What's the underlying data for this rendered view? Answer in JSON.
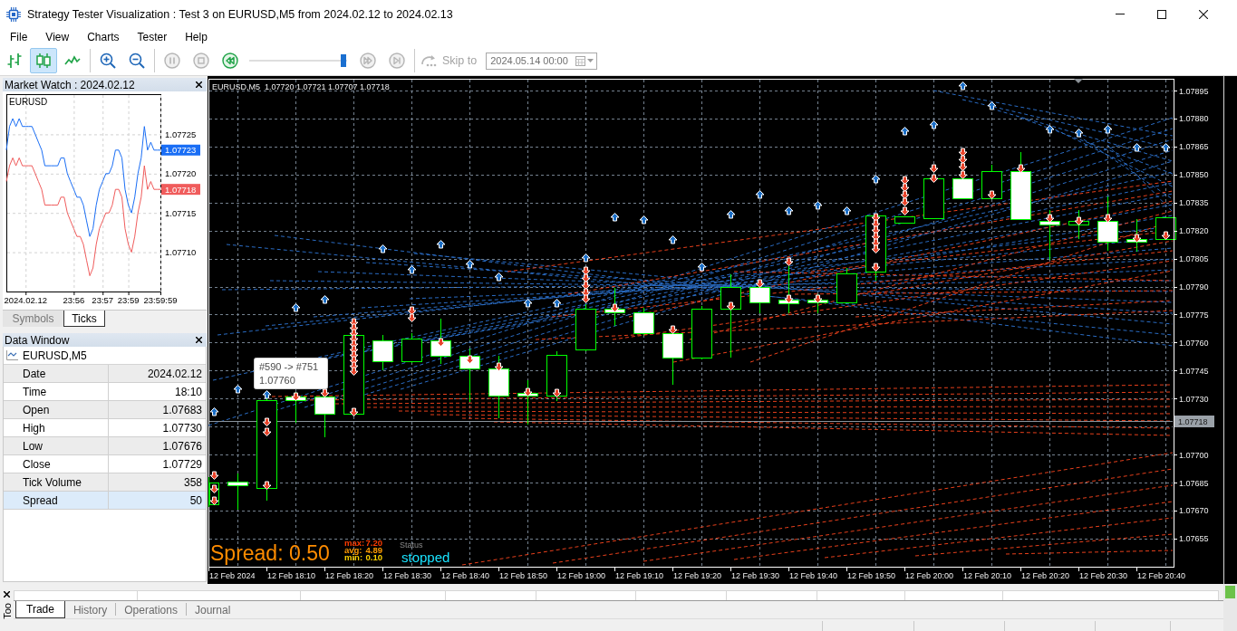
{
  "window": {
    "title": "Strategy Tester Visualization : Test 3 on EURUSD,M5 from 2024.02.12 to 2024.02.13"
  },
  "menu": [
    "File",
    "View",
    "Charts",
    "Tester",
    "Help"
  ],
  "toolbar": {
    "chart_modes": [
      {
        "kind": "bars",
        "selected": false
      },
      {
        "kind": "candles",
        "selected": true
      },
      {
        "kind": "line",
        "selected": false
      }
    ],
    "zoom": [
      {
        "kind": "zoom-in"
      },
      {
        "kind": "zoom-out"
      }
    ],
    "playback": [
      {
        "kind": "pause",
        "disabled": true
      },
      {
        "kind": "stop",
        "disabled": true
      },
      {
        "kind": "rewind",
        "disabled": false
      }
    ],
    "speed": {
      "level": 0.99
    },
    "stepping": [
      {
        "kind": "forward",
        "disabled": true
      },
      {
        "kind": "to-end",
        "disabled": true
      }
    ],
    "skip_to": {
      "label": "Skip to",
      "value": "2024.05.14 00:00",
      "disabled": true
    }
  },
  "market_watch": {
    "title": "Market Watch : 2024.02.12",
    "chart_data": {
      "type": "line",
      "title": "EURUSD",
      "grid": true,
      "categories": [
        null,
        null,
        null,
        null,
        null,
        null,
        "2024.02.12",
        null,
        null,
        null,
        null,
        null,
        null,
        null,
        null,
        null,
        null,
        null,
        null,
        null,
        null,
        "23:56",
        null,
        null,
        null,
        null,
        null,
        null,
        null,
        null,
        "23:57",
        null,
        null,
        null,
        null,
        null,
        null,
        null,
        "23:59",
        null,
        null,
        null,
        null,
        null,
        null,
        null,
        null,
        null,
        "23:59:59"
      ],
      "ylim": [
        1.07705,
        1.0773
      ],
      "yticks": [
        {
          "value": 1.07725,
          "label": "1.07725"
        },
        {
          "value": 1.0772,
          "label": "1.07720"
        },
        {
          "value": 1.07715,
          "label": "1.07715"
        },
        {
          "value": 1.0771,
          "label": "1.07710"
        }
      ],
      "series": [
        {
          "color": "#1a6ef5",
          "values": [
            1.07723,
            1.07726,
            1.07727,
            1.07726,
            1.07727,
            1.07726,
            1.07726,
            1.07726,
            1.07726,
            1.07725,
            1.07724,
            1.07723,
            1.07721,
            1.07721,
            1.07721,
            1.07721,
            1.07721,
            1.07722,
            1.07722,
            1.0772,
            1.07719,
            1.07718,
            1.07717,
            1.07717,
            1.07716,
            1.07714,
            1.07712,
            1.07713,
            1.07716,
            1.07718,
            1.07719,
            1.0772,
            1.0772,
            1.07721,
            1.07723,
            1.07723,
            1.07722,
            1.07718,
            1.07716,
            1.07715,
            1.07717,
            1.0772,
            1.07722,
            1.07726,
            1.07723,
            1.07724,
            1.07723,
            1.07723,
            1.07723
          ]
        },
        {
          "color": "#f05c5c",
          "values": [
            1.07719,
            1.07721,
            1.07722,
            1.07721,
            1.07722,
            1.07721,
            1.07721,
            1.07721,
            1.07721,
            1.0772,
            1.07719,
            1.07718,
            1.07716,
            1.07716,
            1.07716,
            1.07716,
            1.07716,
            1.07717,
            1.07717,
            1.07715,
            1.07714,
            1.07713,
            1.07712,
            1.07712,
            1.07711,
            1.07709,
            1.07707,
            1.07708,
            1.07711,
            1.07713,
            1.07714,
            1.07715,
            1.07715,
            1.07716,
            1.07718,
            1.07718,
            1.07717,
            1.07713,
            1.07711,
            1.0771,
            1.07712,
            1.07715,
            1.07717,
            1.07721,
            1.07718,
            1.07719,
            1.07718,
            1.07718,
            1.07718
          ]
        }
      ]
    },
    "price_badges": [
      "1.07723",
      "1.07718"
    ],
    "tabs": [
      {
        "label": "Symbols",
        "selected": false
      },
      {
        "label": "Ticks",
        "selected": true
      }
    ]
  },
  "data_window": {
    "title": "Data Window",
    "series": "EURUSD,M5",
    "rows": [
      {
        "label": "Date",
        "value": "2024.02.12",
        "selected": false
      },
      {
        "label": "Time",
        "value": "18:10",
        "selected": false
      },
      {
        "label": "Open",
        "value": "1.07683",
        "selected": false
      },
      {
        "label": "High",
        "value": "1.07730",
        "selected": false
      },
      {
        "label": "Low",
        "value": "1.07676",
        "selected": false
      },
      {
        "label": "Close",
        "value": "1.07729",
        "selected": false
      },
      {
        "label": "Tick Volume",
        "value": "358",
        "selected": false
      },
      {
        "label": "Spread",
        "value": "50",
        "selected": true
      }
    ]
  },
  "chart": {
    "symbol": "EURUSD,M5",
    "ohlc": [
      "1.07720",
      "1.07721",
      "1.07707",
      "1.07718"
    ],
    "price_labels": [
      "1.07895",
      "1.07880",
      "1.07865",
      "1.07850",
      "1.07835",
      "1.07820",
      "1.07805",
      "1.07790",
      "1.07775",
      "1.07760",
      "1.07745",
      "1.07730",
      "1.07700",
      "1.07685",
      "1.07670",
      "1.07655"
    ],
    "current_price": "1.07718",
    "time_labels": [
      "12 Feb 2024",
      "12 Feb 18:10",
      "12 Feb 18:20",
      "12 Feb 18:30",
      "12 Feb 18:40",
      "12 Feb 18:50",
      "12 Feb 19:00",
      "12 Feb 19:10",
      "12 Feb 19:20",
      "12 Feb 19:30",
      "12 Feb 19:40",
      "12 Feb 19:50",
      "12 Feb 20:00",
      "12 Feb 20:10",
      "12 Feb 20:20",
      "12 Feb 20:30",
      "12 Feb 20:40"
    ],
    "tooltip": [
      "#590 -> #751",
      "1.07760"
    ],
    "spread": {
      "text": "Spread: 0.50",
      "stats": [
        {
          "label": "max:",
          "value": "7.20",
          "color": "#ff3c00"
        },
        {
          "label": "avg:",
          "value": "4.89",
          "color": "#ff9a00"
        },
        {
          "label": "min:",
          "value": "0.10",
          "color": "#ffd200"
        }
      ]
    },
    "status": {
      "label": "Status",
      "value": "stopped"
    }
  },
  "toolbox": {
    "title": "Too",
    "tabs": [
      {
        "label": "Trade",
        "selected": true
      },
      {
        "label": "History",
        "selected": false
      },
      {
        "label": "Operations",
        "selected": false
      },
      {
        "label": "Journal",
        "selected": false
      }
    ]
  }
}
